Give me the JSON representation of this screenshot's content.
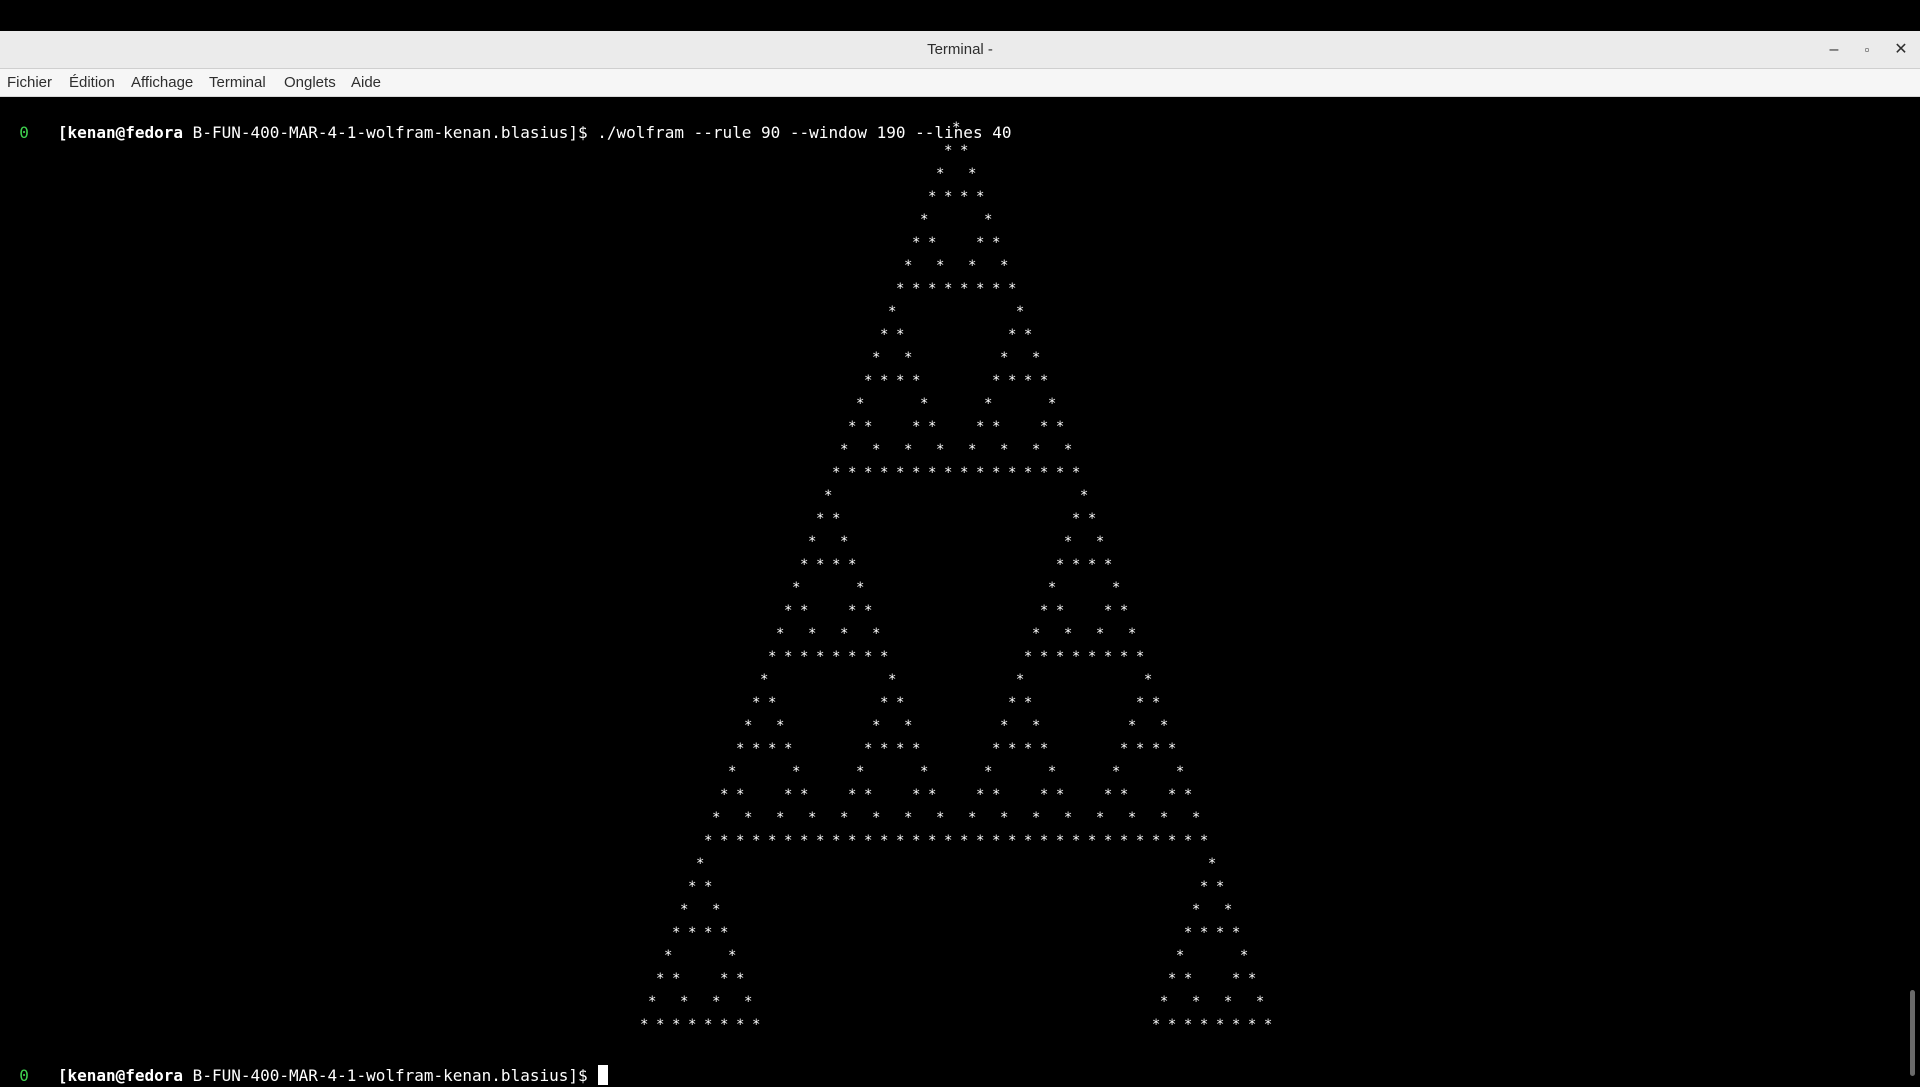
{
  "window": {
    "title": "Terminal -",
    "controls": {
      "minimize": "–",
      "maximize": "▫",
      "close": "✕"
    }
  },
  "menu": [
    "Fichier",
    "Édition",
    "Affichage",
    "Terminal",
    "Onglets",
    "Aide"
  ],
  "terminal": {
    "prompt_indicator": "0",
    "prompt_user": "[kenan@fedora",
    "prompt_dir": " B-FUN-400-MAR-4-1-wolfram-kenan.blasius]$",
    "command": " ./wolfram --rule 90 --window 190 --lines 40",
    "output_rows": 40,
    "output_rule": 90
  },
  "colors": {
    "background": "#000000",
    "text": "#ffffff",
    "indicator": "#3fd34f"
  }
}
